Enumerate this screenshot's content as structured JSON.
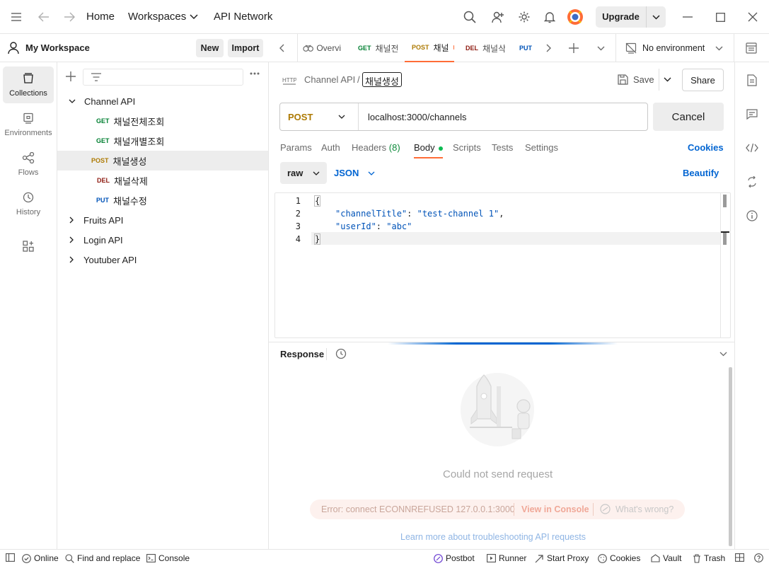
{
  "topbar": {
    "home": "Home",
    "workspaces": "Workspaces",
    "api_network": "API Network",
    "upgrade": "Upgrade"
  },
  "workspace": {
    "name": "My Workspace",
    "new_label": "New",
    "import_label": "Import"
  },
  "rail": [
    {
      "label": "Collections",
      "icon": "collections-icon"
    },
    {
      "label": "Environments",
      "icon": "environments-icon"
    },
    {
      "label": "Flows",
      "icon": "flows-icon"
    },
    {
      "label": "History",
      "icon": "history-icon"
    }
  ],
  "collections": [
    {
      "name": "Channel API",
      "expanded": true,
      "requests": [
        {
          "method": "GET",
          "name": "채널전체조회"
        },
        {
          "method": "GET",
          "name": "채널개별조회"
        },
        {
          "method": "POST",
          "name": "채널생성",
          "selected": true
        },
        {
          "method": "DEL",
          "name": "채널삭제"
        },
        {
          "method": "PUT",
          "name": "채널수정"
        }
      ]
    },
    {
      "name": "Fruits API",
      "expanded": false
    },
    {
      "name": "Login API",
      "expanded": false
    },
    {
      "name": "Youtuber API",
      "expanded": false
    }
  ],
  "tabs": [
    {
      "method": "",
      "label": "Overvi"
    },
    {
      "method": "GET",
      "label": "채널전"
    },
    {
      "method": "POST",
      "label": "채널",
      "active": true,
      "unsaved": true
    },
    {
      "method": "DEL",
      "label": "채널삭"
    },
    {
      "method": "PUT",
      "label": ""
    }
  ],
  "environment": "No environment",
  "request": {
    "breadcrumb_parent": "Channel API",
    "breadcrumb_sep": "/",
    "name": "채널생성",
    "save_label": "Save",
    "share_label": "Share",
    "method": "POST",
    "url": "localhost:3000/channels",
    "cancel_label": "Cancel",
    "tabs": {
      "params": "Params",
      "auth": "Auth",
      "headers": "Headers",
      "headers_count": "(8)",
      "body": "Body",
      "scripts": "Scripts",
      "tests": "Tests",
      "settings": "Settings",
      "cookies": "Cookies"
    },
    "body_mode": "raw",
    "body_format": "JSON",
    "beautify": "Beautify",
    "lines": [
      "1",
      "2",
      "3",
      "4"
    ],
    "code": {
      "open": "{",
      "k1": "\"channelTitle\"",
      "v1": "\"test-channel 1\"",
      "k2": "\"userId\"",
      "v2": "\"abc\"",
      "close": "}"
    }
  },
  "response": {
    "title": "Response",
    "message": "Could not send request",
    "error": "Error: connect ECONNREFUSED 127.0.0.1:3000",
    "view_console": "View in Console",
    "whats_wrong": "What's wrong?",
    "learn_more": "Learn more about troubleshooting API requests"
  },
  "status": {
    "online": "Online",
    "find_replace": "Find and replace",
    "console": "Console",
    "postbot": "Postbot",
    "runner": "Runner",
    "start_proxy": "Start Proxy",
    "cookies": "Cookies",
    "vault": "Vault",
    "trash": "Trash"
  },
  "colors": {
    "accent": "#ff6c37",
    "get": "#007f31",
    "post": "#ad7a03",
    "del": "#8e1a10",
    "put": "#0053b8",
    "link": "#0265d2"
  }
}
